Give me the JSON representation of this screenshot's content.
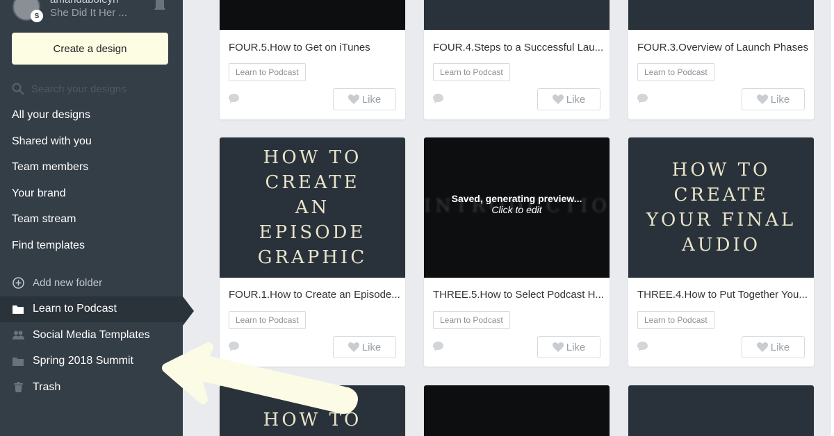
{
  "user": {
    "name": "amandaboleyn",
    "team": "She Did It Her ...",
    "badge": "S"
  },
  "sidebar": {
    "create_label": "Create a design",
    "search_placeholder": "Search your designs",
    "nav": [
      "All your designs",
      "Shared with you",
      "Team members",
      "Your brand",
      "Team stream",
      "Find templates"
    ],
    "add_folder": "Add new folder",
    "folders": [
      {
        "label": "Learn to Podcast",
        "icon": "folder-icon",
        "active": true
      },
      {
        "label": "Social Media Templates",
        "icon": "people-icon"
      },
      {
        "label": "Spring 2018 Summit",
        "icon": "folder-icon"
      },
      {
        "label": "Trash",
        "icon": "trash-icon"
      }
    ]
  },
  "cards": [
    {
      "title": "FOUR.5.How to Get on iTunes",
      "tag": "Learn to Podcast",
      "like": "Like"
    },
    {
      "title": "FOUR.4.Steps to a Successful Lau...",
      "tag": "Learn to Podcast",
      "like": "Like"
    },
    {
      "title": "FOUR.3.Overview of Launch Phases",
      "tag": "Learn to Podcast",
      "like": "Like"
    },
    {
      "title": "FOUR.1.How to Create an Episode...",
      "tag": "Learn to Podcast",
      "like": "Like",
      "thumb_text": "HOW TO CREATE AN EPISODE GRAPHIC"
    },
    {
      "title": "THREE.5.How to Select Podcast H...",
      "tag": "Learn to Podcast",
      "like": "Like",
      "saved_line1": "Saved, generating preview...",
      "saved_line2": "Click to edit",
      "ghost_text": "INTRODUCTION"
    },
    {
      "title": "THREE.4.How to Put Together You...",
      "tag": "Learn to Podcast",
      "like": "Like",
      "thumb_text": "HOW TO CREATE YOUR FINAL AUDIO"
    },
    {
      "thumb_text": "HOW TO"
    }
  ],
  "colors": {
    "sidebar": "#343e47",
    "create_button": "#fdfde3",
    "thumb_dark": "#29323a",
    "arrow": "#fbfbe6"
  }
}
